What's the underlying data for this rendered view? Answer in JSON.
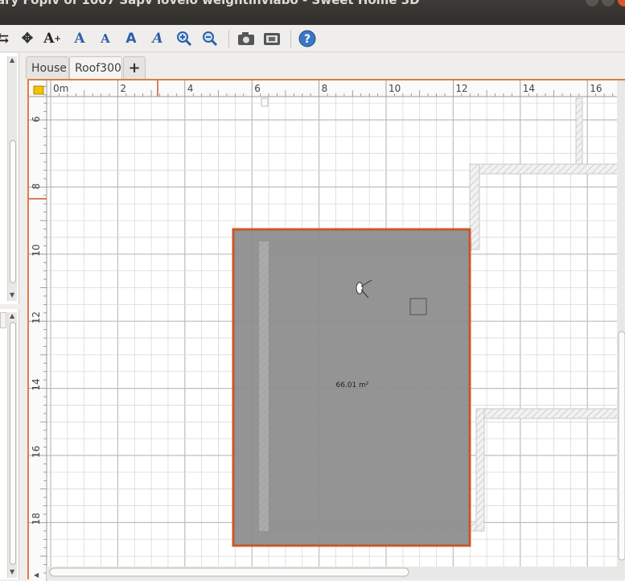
{
  "window": {
    "title": "ary Fopiv of 1007 Sapv lovelo weightinvlabo - Sweet Home 3D"
  },
  "toolbar": {
    "icons": [
      "plan-select-arrows-icon",
      "pan-icon",
      "add-text-icon",
      "increase-text-size-icon",
      "decrease-text-size-icon",
      "bold-text-icon",
      "italic-text-icon",
      "zoom-in-icon",
      "zoom-out-icon",
      "create-photo-icon",
      "create-video-icon",
      "help-icon"
    ]
  },
  "tabs": {
    "house": "House",
    "roof": "Roof300",
    "add": "+"
  },
  "plan": {
    "ruler_x_labels": [
      "0m",
      "2",
      "4",
      "6",
      "8",
      "10",
      "12",
      "14",
      "16"
    ],
    "ruler_y_labels": [
      "6",
      "8",
      "10",
      "12",
      "14",
      "16",
      "18"
    ],
    "room_area": "66.01 m²",
    "colors": {
      "room_fill": "#8c8c8c",
      "selection": "#c8582a",
      "grid": "#d9d9d9",
      "grid_major": "#bdbdbd",
      "wall_hatch": "#cfcfcf"
    }
  }
}
